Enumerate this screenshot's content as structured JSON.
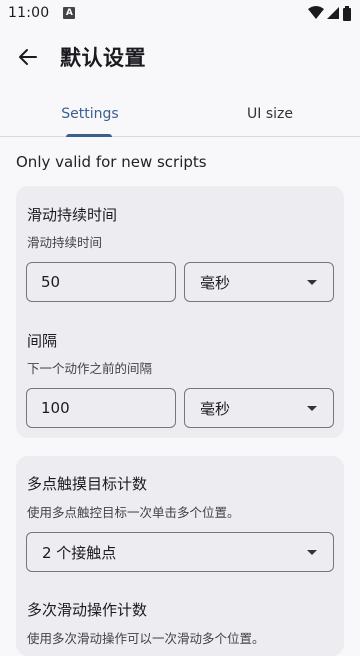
{
  "status": {
    "time": "11:00",
    "notification_icon": "A"
  },
  "app_bar": {
    "title": "默认设置"
  },
  "tabs": [
    {
      "label": "Settings",
      "active": true
    },
    {
      "label": "UI size",
      "active": false
    }
  ],
  "note": "Only valid for new scripts",
  "card1": {
    "swipe_duration": {
      "title": "滑动持续时间",
      "subtitle": "滑动持续时间",
      "value": "50",
      "unit": "毫秒"
    },
    "interval": {
      "title": "间隔",
      "subtitle": "下一个动作之前的间隔",
      "value": "100",
      "unit": "毫秒"
    }
  },
  "card2": {
    "multi_touch": {
      "title": "多点触摸目标计数",
      "subtitle": "使用多点触控目标一次单击多个位置。",
      "selected": "2 个接触点"
    },
    "multi_swipe": {
      "title": "多次滑动操作计数",
      "subtitle": "使用多次滑动操作可以一次滑动多个位置。"
    }
  },
  "colors": {
    "accent": "#3a5f8f",
    "card_bg": "#ececf1",
    "page_bg": "#f8f8fb"
  }
}
